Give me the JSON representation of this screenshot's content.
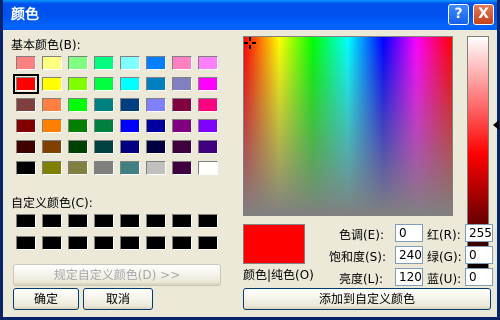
{
  "window": {
    "title": "颜色",
    "help_glyph": "?",
    "close_glyph": "X"
  },
  "basic_colors": {
    "label": "基本颜色(B):",
    "selected_index": 8,
    "colors": [
      "#ff8080",
      "#ffff80",
      "#80ff80",
      "#00ff80",
      "#80ffff",
      "#0080ff",
      "#ff80c0",
      "#ff80ff",
      "#ff0000",
      "#ffff00",
      "#80ff00",
      "#00ff40",
      "#00ffff",
      "#0080c0",
      "#8080c0",
      "#ff00ff",
      "#804040",
      "#ff8040",
      "#00ff00",
      "#008080",
      "#004080",
      "#8080ff",
      "#800040",
      "#ff0080",
      "#800000",
      "#ff8000",
      "#008000",
      "#008040",
      "#0000ff",
      "#0000a0",
      "#800080",
      "#8000ff",
      "#400000",
      "#804000",
      "#004000",
      "#004040",
      "#000080",
      "#000040",
      "#400040",
      "#400080",
      "#000000",
      "#808000",
      "#808040",
      "#808080",
      "#408080",
      "#c0c0c0",
      "#400040",
      "#ffffff"
    ]
  },
  "custom_colors": {
    "label": "自定义颜色(C):",
    "count": 16,
    "color": "#000000"
  },
  "buttons": {
    "define_custom": "规定自定义颜色(D) >>",
    "ok": "确定",
    "cancel": "取消",
    "add_custom": "添加到自定义颜色"
  },
  "preview": {
    "label": "颜色|纯色(O)",
    "color": "#ff0000"
  },
  "fields": {
    "hue_label": "色调(E):",
    "hue": "0",
    "sat_label": "饱和度(S):",
    "sat": "240",
    "lum_label": "亮度(L):",
    "lum": "120",
    "red_label": "红(R):",
    "red": "255",
    "green_label": "绿(G):",
    "green": "0",
    "blue_label": "蓝(U):",
    "blue": "0"
  },
  "icons": {
    "crosshair": "crosshair-icon",
    "luminance_arrow": "arrow-left-icon"
  }
}
